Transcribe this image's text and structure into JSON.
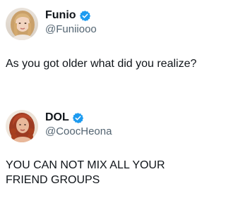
{
  "posts": [
    {
      "display_name": "Funio",
      "handle": "@Funiiooo",
      "verified": true,
      "avatar_icon": "avatar-portrait-blonde",
      "text": "As you got older what did you realize?"
    },
    {
      "display_name": "DOL",
      "handle": "@CoocHeona",
      "verified": true,
      "avatar_icon": "avatar-portrait-red-hair",
      "text": "YOU CAN NOT MIX ALL YOUR FRIEND GROUPS"
    }
  ],
  "colors": {
    "verified_badge": "#1d9bf0",
    "text_primary": "#0f1419",
    "text_secondary": "#536471",
    "background": "#ffffff"
  }
}
